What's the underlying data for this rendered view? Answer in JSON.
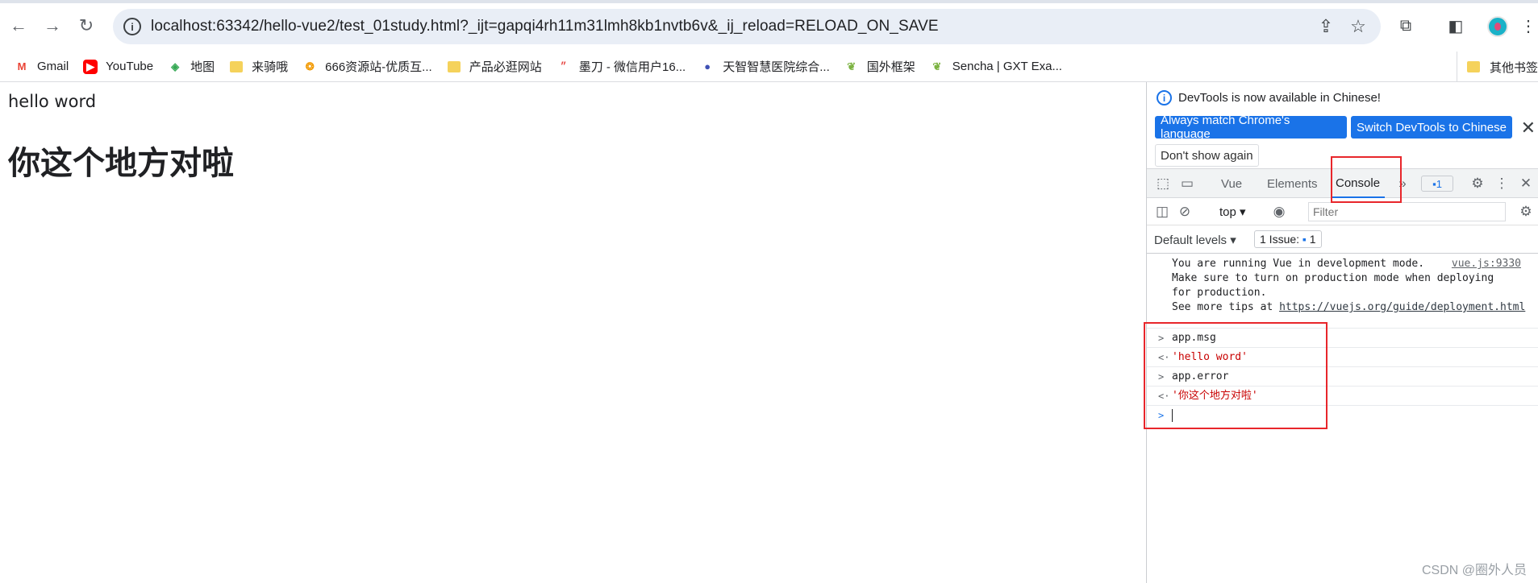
{
  "browser": {
    "url": "localhost:63342/hello-vue2/test_01study.html?_ijt=gapqi4rh11m31lmh8kb1nvtb6v&_ij_reload=RELOAD_ON_SAVE"
  },
  "bookmarks": {
    "items": [
      {
        "label": "Gmail",
        "icon": "gmail-icon"
      },
      {
        "label": "YouTube",
        "icon": "youtube-icon"
      },
      {
        "label": "地图",
        "icon": "maps-icon"
      },
      {
        "label": "来骑哦",
        "icon": "folder-icon"
      },
      {
        "label": "666资源站-优质互...",
        "icon": "site-icon"
      },
      {
        "label": "产品必逛网站",
        "icon": "folder-icon"
      },
      {
        "label": "墨刀 - 微信用户16...",
        "icon": "modao-icon"
      },
      {
        "label": "天智智慧医院综合...",
        "icon": "site-icon"
      },
      {
        "label": "国外框架",
        "icon": "leaf-icon"
      },
      {
        "label": "Sencha | GXT Exa...",
        "icon": "leaf-icon"
      }
    ],
    "other": "其他书签"
  },
  "page": {
    "message": "hello word",
    "heading": "你这个地方对啦",
    "watermark": "CSDN @圈外人员"
  },
  "devtools": {
    "banner": {
      "text": "DevTools is now available in Chinese!",
      "match_button": "Always match Chrome's language",
      "switch_button": "Switch DevTools to Chinese",
      "dont_show": "Don't show again"
    },
    "tabs": {
      "vue": "Vue",
      "elements": "Elements",
      "console": "Console",
      "issues_count": "1"
    },
    "filterbar": {
      "context": "top",
      "filter_placeholder": "Filter"
    },
    "levels": {
      "label": "Default levels",
      "issue": "1 Issue:",
      "issue_count": "1"
    },
    "console": {
      "log_line1": "You are running Vue in development mode.",
      "log_source": "vue.js:9330",
      "log_line2": "Make sure to turn on production mode when deploying",
      "log_line3": "for production.",
      "log_line4_prefix": "See more tips at ",
      "log_link": "https://vuejs.org/guide/deployment.html",
      "cmd1": "app.msg",
      "res1": "'hello word'",
      "cmd2": "app.error",
      "res2": "'你这个地方对啦'"
    }
  },
  "colors": {
    "accent": "#1a73e8",
    "highlight": "#e8262b",
    "result": "#c80000"
  }
}
